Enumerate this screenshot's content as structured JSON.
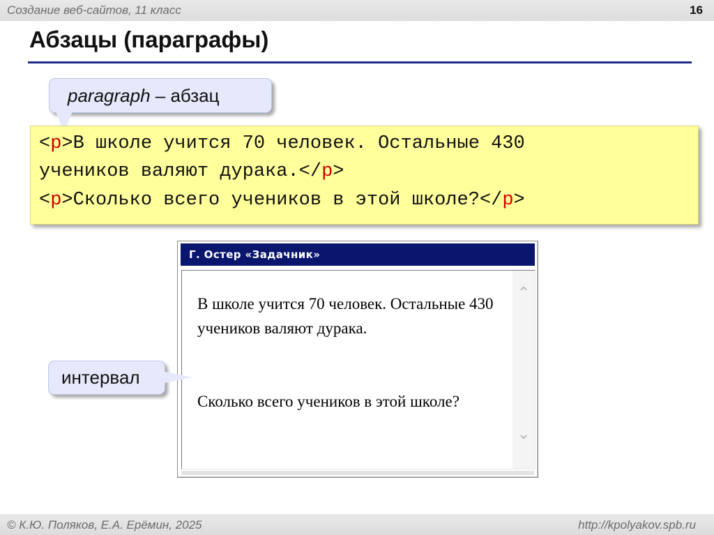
{
  "header": {
    "course": "Создание веб-сайтов, 11 класс",
    "slide_number": "16"
  },
  "title": "Абзацы (параграфы)",
  "callouts": {
    "paragraph": {
      "italic": "paragraph",
      "rest": " – абзац"
    },
    "interval": "интервал"
  },
  "code": {
    "line1": {
      "open": "<",
      "tag": "p",
      "close": ">",
      "text": "В школе учится 70 человек. Остальные 430"
    },
    "line2": {
      "text": "учеников валяют дурака.",
      "open": "</",
      "tag": "p",
      "close": ">"
    },
    "line3": {
      "open": "<",
      "tag": "p",
      "close": ">",
      "text": "Сколько всего учеников в этой школе?",
      "end_open": "</",
      "end_tag": "p",
      "end_close": ">"
    }
  },
  "browser_window": {
    "title": "Г. Остер «Задачник»",
    "paragraph1": "В школе учится 70 человек. Остальные 430 учеников валяют дурака.",
    "paragraph2": "Сколько всего учеников в этой школе?"
  },
  "footer": {
    "authors": "© К.Ю. Поляков, Е.А. Ерёмин, 2025",
    "site": "http://kpolyakov.spb.ru"
  },
  "colors": {
    "title_rule": "#1f2a8a",
    "code_background": "#ffff9c",
    "tag_red": "#d40000",
    "window_titlebar": "#0a166e",
    "callout_fill": "#e6e9fb"
  },
  "icons": {
    "scroll_up": "chevron-up-icon",
    "scroll_down": "chevron-down-icon"
  }
}
